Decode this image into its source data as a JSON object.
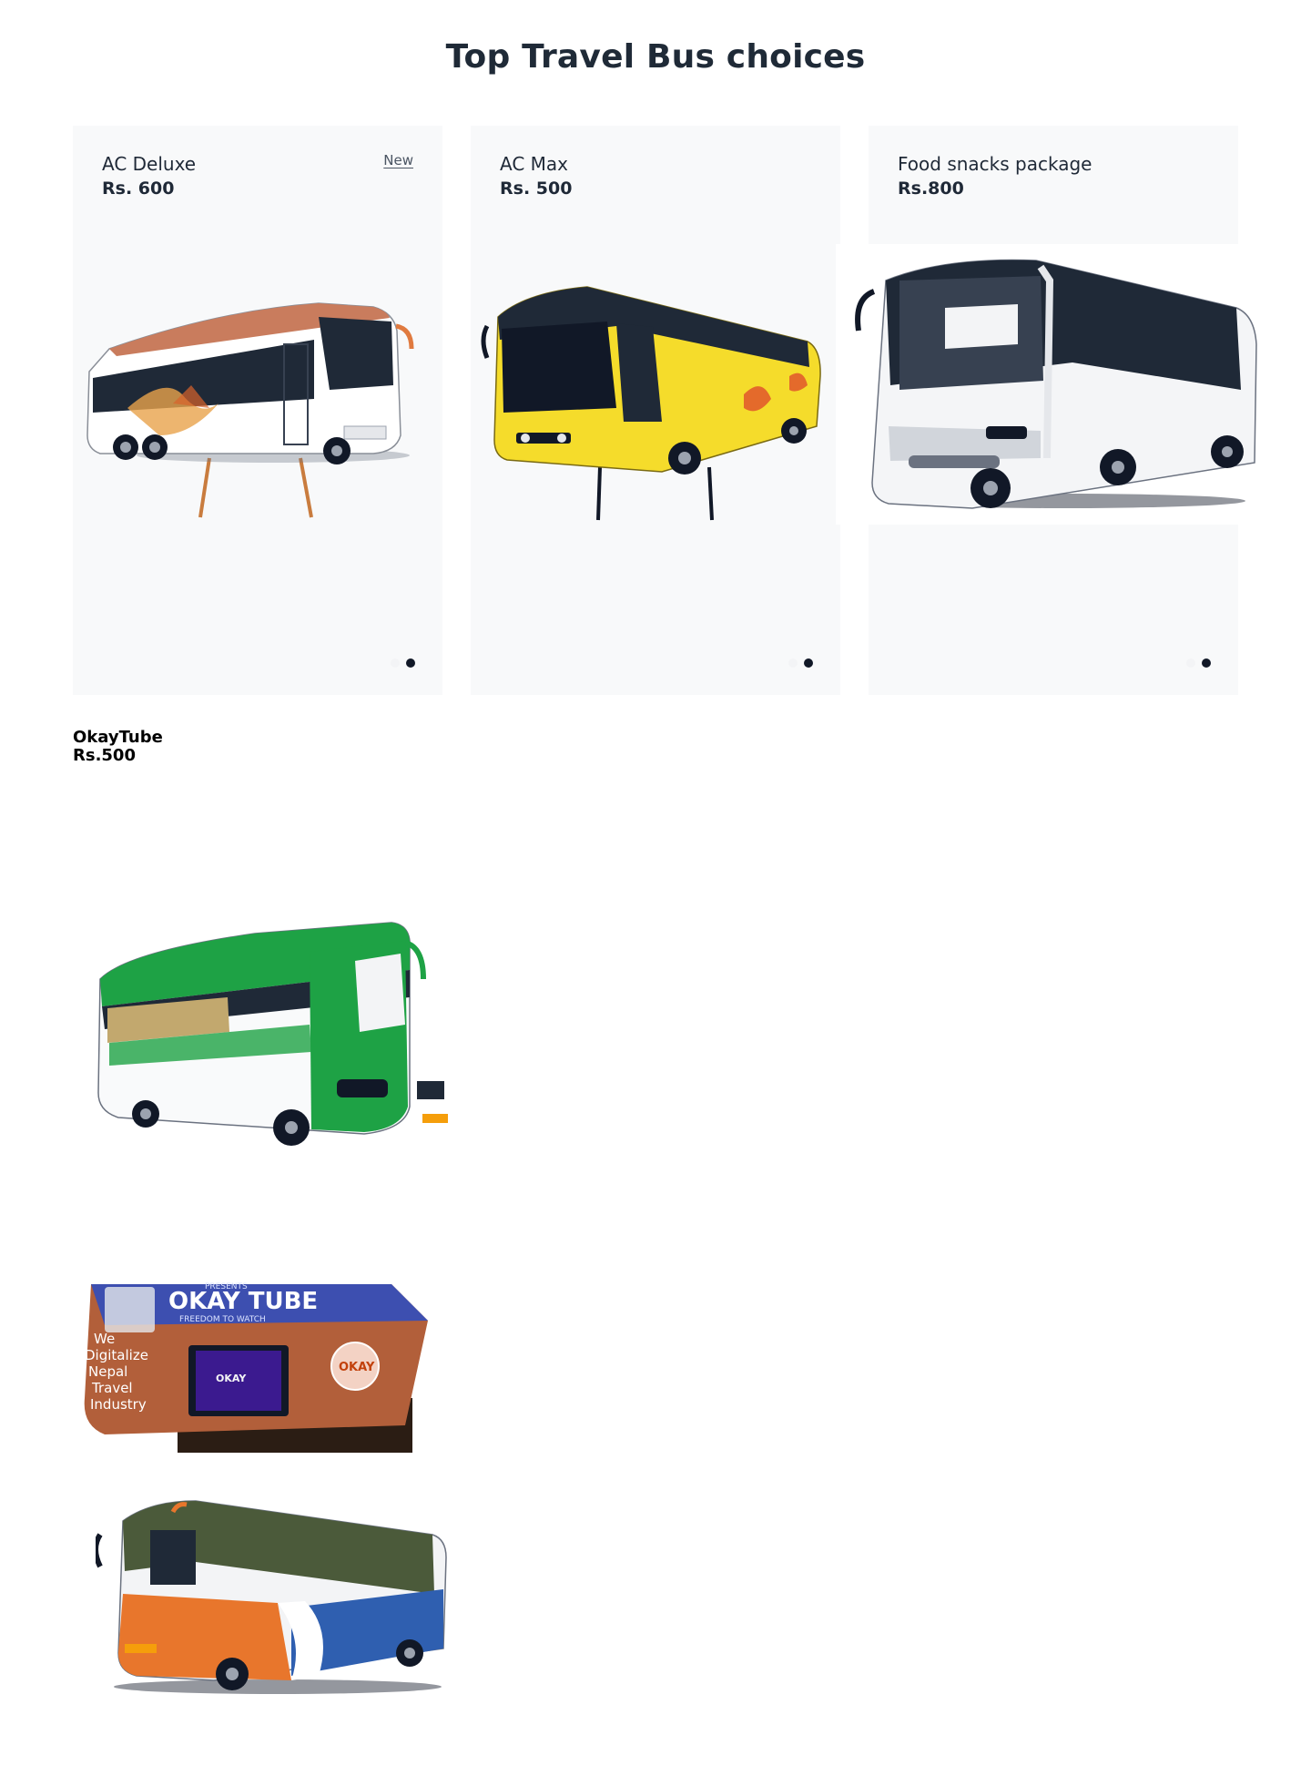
{
  "page": {
    "title": "Top Travel Bus choices"
  },
  "cards": [
    {
      "name": "AC Deluxe",
      "price": "Rs. 600",
      "badge": "New",
      "image_icon": "white-orange-bus-image",
      "carousel": {
        "total": 2,
        "active": 2
      }
    },
    {
      "name": "AC Max",
      "price": "Rs. 500",
      "image_icon": "yellow-bus-image",
      "carousel": {
        "total": 2,
        "active": 2
      }
    },
    {
      "name": "Food snacks package",
      "price": "Rs.800",
      "image_icon": "white-bus-image",
      "carousel": {
        "total": 2,
        "active": 2
      }
    }
  ],
  "extra_product": {
    "name": "OkayTube",
    "price": "Rs.500",
    "images": [
      {
        "icon": "green-bus-image"
      },
      {
        "icon": "okaytube-box-image",
        "box_text": {
          "presents": "PRESENTS",
          "brand": "OKAY TUBE",
          "tagline": "FREEDOM TO WATCH",
          "slogan": [
            "We",
            "Digitalize",
            "Nepal",
            "Travel",
            "Industry"
          ],
          "badge": "OKAY",
          "screen": "OKAY"
        }
      },
      {
        "icon": "orange-blue-bus-image"
      }
    ]
  },
  "colors": {
    "card_bg": "#f8f9fa",
    "title": "#1f2a37",
    "dot_active": "#111827",
    "dot_inactive": "#f3f4f6"
  }
}
